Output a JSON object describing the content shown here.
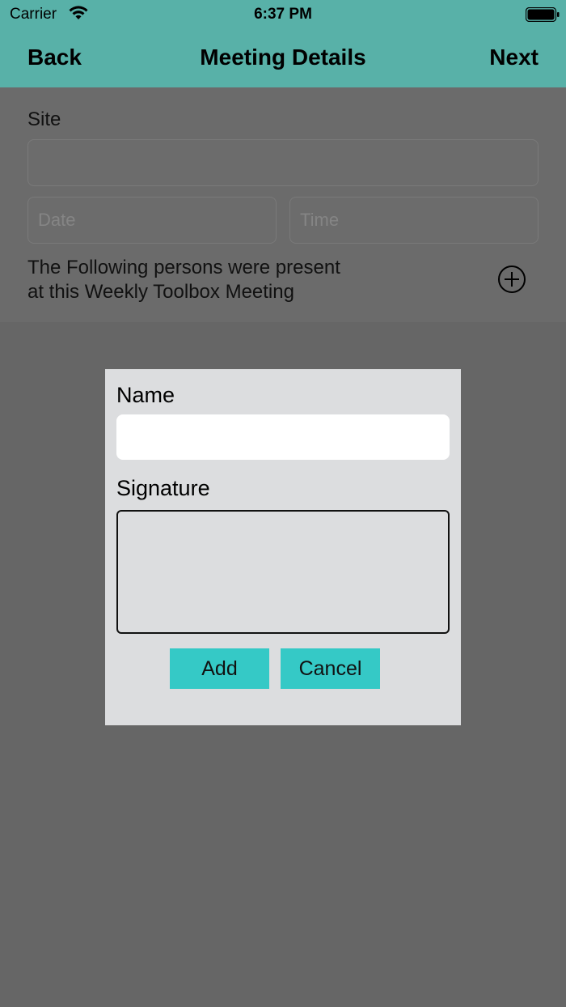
{
  "status_bar": {
    "carrier": "Carrier",
    "time": "6:37 PM",
    "wifi_icon": "wifi-icon",
    "battery_icon": "battery-icon"
  },
  "nav": {
    "back": "Back",
    "title": "Meeting Details",
    "next": "Next"
  },
  "form": {
    "site_label": "Site",
    "site_value": "",
    "date_placeholder": "Date",
    "time_placeholder": "Time",
    "persons_text_line1": "The Following persons were present",
    "persons_text_line2": "at this Weekly Toolbox Meeting",
    "add_icon": "plus-circle-icon"
  },
  "modal": {
    "name_label": "Name",
    "name_value": "",
    "signature_label": "Signature",
    "add_button": "Add",
    "cancel_button": "Cancel"
  },
  "colors": {
    "nav_bar": "#58b1a8",
    "overlay": "#666666",
    "modal_bg": "#dcdddf",
    "button_accent": "#35c9c6"
  }
}
